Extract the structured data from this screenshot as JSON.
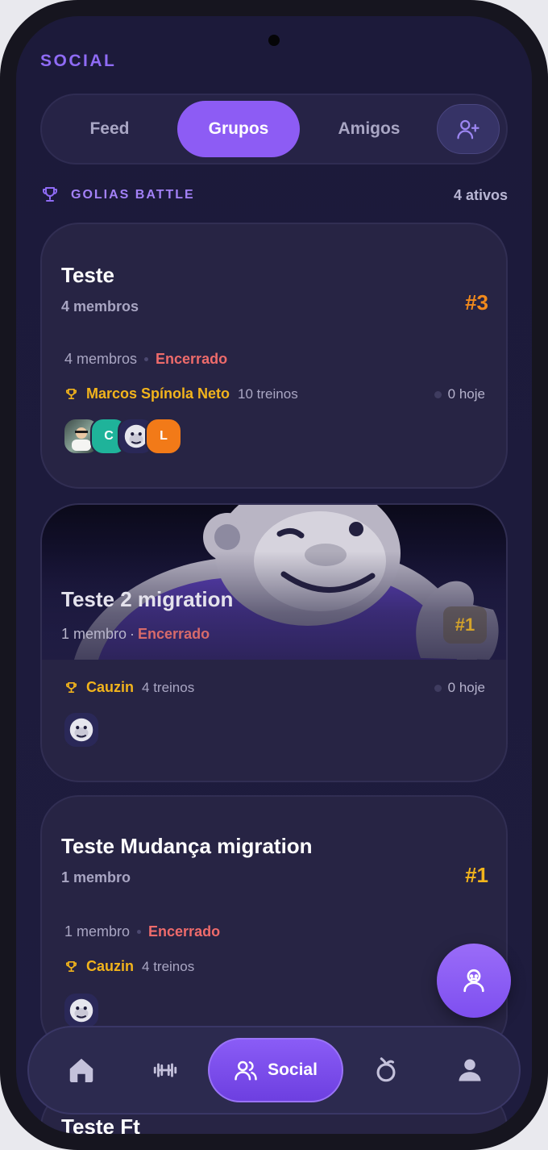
{
  "header": {
    "title": "SOCIAL"
  },
  "tabs": [
    {
      "label": "Feed",
      "active": false
    },
    {
      "label": "Grupos",
      "active": true
    },
    {
      "label": "Amigos",
      "active": false
    }
  ],
  "section": {
    "title": "GOLIAS BATTLE",
    "count": "4 ativos"
  },
  "groups": [
    {
      "name": "Teste",
      "members_label": "4 membros",
      "rank": "#3",
      "rank_color": "#f28a1c",
      "meta_members": "4 membros",
      "status": "Encerrado",
      "leader": "Marcos Spínola Neto",
      "leader_workouts": "10 treinos",
      "today": "0 hoje",
      "avatars": [
        "photo",
        "C",
        "gorilla",
        "L"
      ]
    },
    {
      "name": "Teste 2 migration",
      "members_label": "1 membro",
      "status": "Encerrado",
      "rank": "#1",
      "leader": "Cauzin",
      "leader_workouts": "4 treinos",
      "today": "0 hoje",
      "avatars": [
        "gorilla"
      ]
    },
    {
      "name": "Teste Mudança migration",
      "members_label": "1 membro",
      "rank": "#1",
      "rank_color": "#f2b41c",
      "meta_members": "1 membro",
      "status": "Encerrado",
      "leader": "Cauzin",
      "leader_workouts": "4 treinos",
      "avatars": [
        "gorilla"
      ]
    },
    {
      "name": "Teste Ft"
    }
  ],
  "avatar_letters": {
    "c": "C",
    "l": "L"
  },
  "bottom_nav": {
    "items": [
      {
        "icon": "home-icon"
      },
      {
        "icon": "dumbbell-icon"
      },
      {
        "icon": "people-icon",
        "label": "Social",
        "active": true
      },
      {
        "icon": "apple-icon"
      },
      {
        "icon": "person-icon"
      }
    ]
  },
  "colors": {
    "accent": "#8d5cf4",
    "status_closed": "#ee6b6b",
    "leader": "#f2b41c",
    "background": "#1c1a3a"
  }
}
